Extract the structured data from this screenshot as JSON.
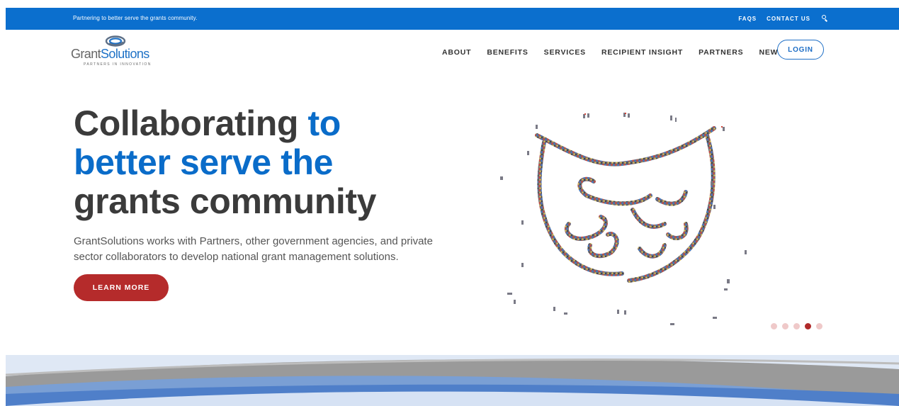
{
  "topbar": {
    "tagline": "Partnering to better serve the grants community.",
    "links": [
      "FAQS",
      "CONTACT US"
    ],
    "search_icon": "search-icon"
  },
  "logo": {
    "word_grant": "Grant",
    "word_solutions": "Solutions",
    "tagline": "PARTNERS IN INNOVATION"
  },
  "nav": {
    "items": [
      "ABOUT",
      "BENEFITS",
      "SERVICES",
      "RECIPIENT INSIGHT",
      "PARTNERS",
      "NEWS"
    ],
    "login": "LOGIN"
  },
  "hero": {
    "title_part1": "Collaborating ",
    "title_part2": "to better serve the",
    "title_part3": "grants community",
    "body": "GrantSolutions works with Partners, other government agencies, and private sector collaborators to develop national grant management solutions.",
    "button": "LEARN MORE"
  },
  "carousel": {
    "slide_count": 5,
    "active_index": 3
  },
  "colors": {
    "brand_blue": "#0b6fce",
    "accent_red": "#b52b2b",
    "dot_inactive": "#efc9c9"
  }
}
